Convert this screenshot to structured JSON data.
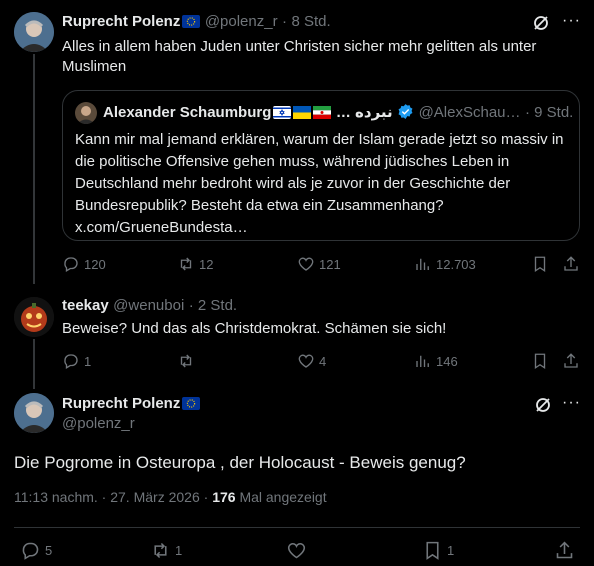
{
  "colors": {
    "background": "#000000",
    "text": "#e7e9ea",
    "muted": "#71767b",
    "border": "#2f3336",
    "verified": "#1d9bf0"
  },
  "tweet1": {
    "author": "Ruprecht Polenz",
    "flag": "eu-flag",
    "handle": "@polenz_r",
    "sep": "·",
    "time": "8 Std.",
    "text": "Alles in allem haben Juden unter Christen sicher mehr gelitten als unter Muslimen",
    "quote": {
      "author": "Alexander Schaumburg",
      "author_suffix": "… نبرده",
      "flags": [
        "israel-flag",
        "ukraine-flag",
        "iran-flag"
      ],
      "handle": "@AlexSchau…",
      "time": "· 9 Std.",
      "text": "Kann mir mal jemand erklären, warum der Islam gerade jetzt so massiv in die politische Offensive gehen muss, während jüdisches Leben in Deutschland mehr bedroht wird als je zuvor in der Geschichte der Bundesrepublik? Besteht da etwa ein Zusammenhang? x.com/GrueneBundesta…"
    },
    "replies": "120",
    "reposts": "12",
    "likes": "121",
    "views": "12.703"
  },
  "tweet2": {
    "author": "teekay",
    "handle": "@wenuboi",
    "time": "· 2 Std.",
    "text": "Beweise? Und das als Christdemokrat. Schämen sie sich!",
    "replies": "1",
    "reposts": "",
    "likes": "4",
    "views": "146"
  },
  "tweet3": {
    "author": "Ruprecht Polenz",
    "flag": "eu-flag",
    "handle": "@polenz_r",
    "text": "Die Pogrome in Osteuropa , der Holocaust - Beweis genug?",
    "timestamp": "11:13 nachm. · 27. März 2026 ·",
    "views_count": "176",
    "views_label": "Mal angezeigt",
    "replies": "5",
    "reposts": "1",
    "likes": "",
    "bookmarks": "1"
  }
}
